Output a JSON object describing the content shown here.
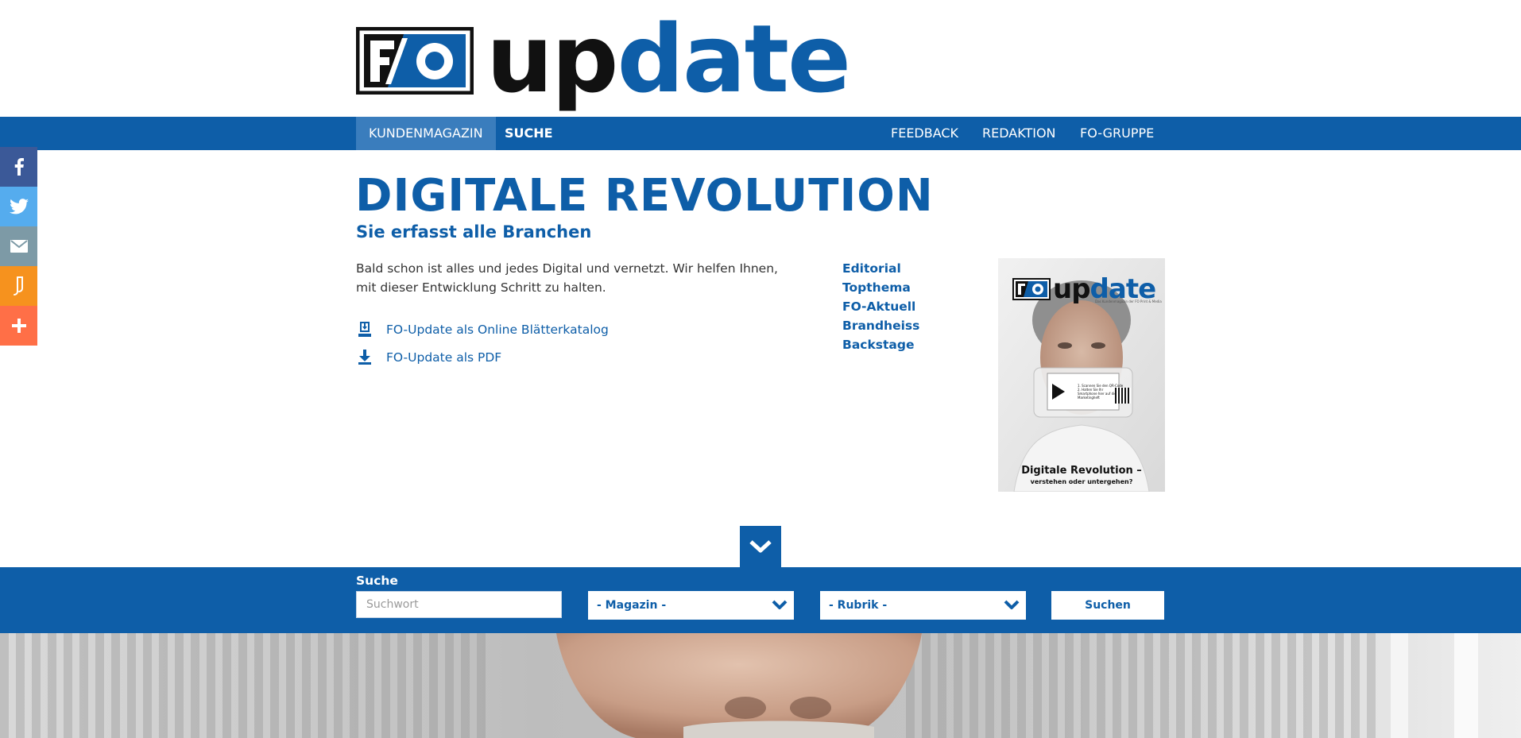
{
  "logo": {
    "badge": "F/O",
    "word_part1": "up",
    "word_part2": "date"
  },
  "nav": {
    "left": [
      {
        "label": "KUNDENMAGAZIN",
        "active": true
      },
      {
        "label": "SUCHE",
        "active": false
      }
    ],
    "right": [
      {
        "label": "FEEDBACK"
      },
      {
        "label": "REDAKTION"
      },
      {
        "label": "FO-GRUPPE"
      }
    ]
  },
  "social": [
    {
      "icon": "facebook-icon",
      "color": "#3b5998"
    },
    {
      "icon": "twitter-icon",
      "color": "#55acee"
    },
    {
      "icon": "email-icon",
      "color": "#7d9aa6"
    },
    {
      "icon": "print-icon",
      "color": "#f6921e"
    },
    {
      "icon": "share-plus-icon",
      "color": "#ff6f47"
    }
  ],
  "main": {
    "title": "DIGITALE REVOLUTION",
    "subtitle": "Sie erfasst alle Branchen",
    "intro": "Bald schon ist alles und jedes Digital und vernetzt. Wir helfen Ihnen, mit dieser Entwicklung Schritt zu halten.",
    "links": [
      {
        "label": "FO-Update als Online Blätterkatalog",
        "icon": "catalog-download-icon"
      },
      {
        "label": "FO-Update als PDF",
        "icon": "pdf-download-icon"
      }
    ],
    "toc": [
      "Editorial",
      "Topthema",
      "FO-Aktuell",
      "Brandheiss",
      "Backstage"
    ],
    "cover": {
      "logo_badge": "F/O",
      "logo_up": "up",
      "logo_date": "date",
      "tagline": "Das Kundenmagazin der FO Print & Media",
      "phone_line1": "1. Scannen Sie den QR-Code",
      "phone_line2": "2. Halten Sie Ihr Smartphone hier auf dieses Marketingheft",
      "headline": "Digitale Revolution –",
      "subheadline": "verstehen oder untergehen?"
    }
  },
  "search": {
    "label": "Suche",
    "placeholder": "Suchwort",
    "magazin_selected": "- Magazin -",
    "rubrik_selected": "- Rubrik -",
    "button": "Suchen"
  },
  "colors": {
    "brand": "#0e5ea8",
    "nav_active": "#3a7dbd"
  }
}
